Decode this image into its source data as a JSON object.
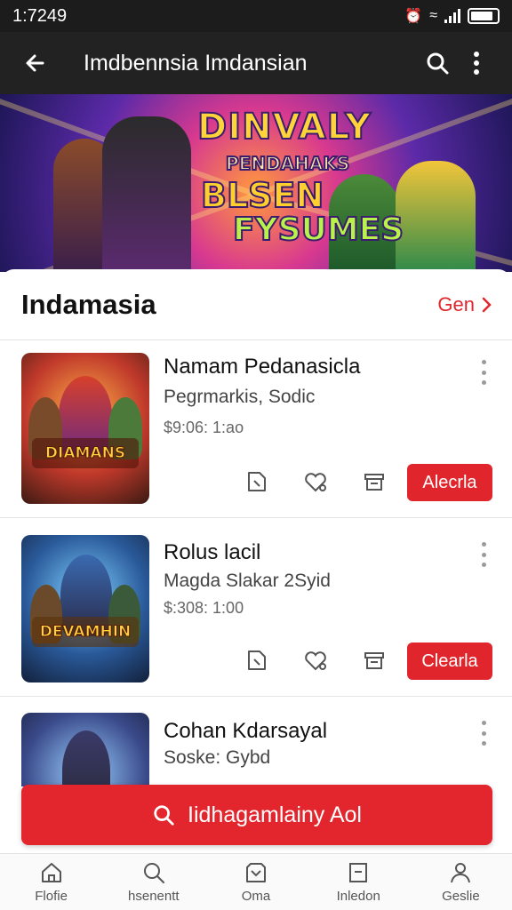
{
  "status_bar": {
    "time": "1:7249"
  },
  "app_bar": {
    "title": "Imdbennsia Imdansian",
    "back_icon": "back-arrow-icon",
    "search_icon": "search-icon",
    "menu_icon": "more-vert-icon"
  },
  "banner": {
    "line1": "DINVALY",
    "line2": "PENDAHAKS",
    "line3": "BLSEN",
    "line4": "FYSUMES"
  },
  "section": {
    "title": "Indamasia",
    "link_label": "Gen"
  },
  "items": [
    {
      "title": "Namam Pedanasicla",
      "subtitle": "Pegrmarkis, Sodic",
      "price": "$9:06: 1:ao",
      "thumb_label": "DIAMANS",
      "cta": "Alecrla"
    },
    {
      "title": "Rolus lacil",
      "subtitle": "Magda Slakar 2Syid",
      "price": "$:308: 1:00",
      "thumb_label": "DEVAMHIN",
      "cta": "Clearla"
    },
    {
      "title": "Cohan Kdarsayal",
      "subtitle": "Soske: Gybd"
    }
  ],
  "main_cta": {
    "label": "Iidhagamlainy Aol"
  },
  "bottom_nav": [
    {
      "label": "Flofie",
      "icon": "home-icon"
    },
    {
      "label": "hsenentt",
      "icon": "search-icon"
    },
    {
      "label": "Oma",
      "icon": "shop-icon"
    },
    {
      "label": "Inledon",
      "icon": "box-icon"
    },
    {
      "label": "Geslie",
      "icon": "profile-icon"
    }
  ],
  "colors": {
    "accent": "#e0262c",
    "app_bar": "#222222",
    "status_bar": "#1c1c1c"
  }
}
